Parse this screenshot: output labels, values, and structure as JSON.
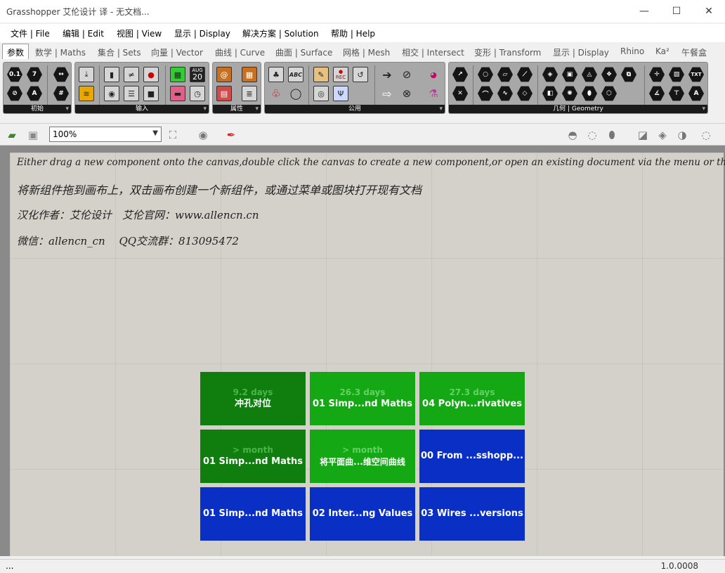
{
  "window": {
    "title": "Grasshopper 艾伦设计 译 - 无文档..."
  },
  "menu": [
    "文件 | File",
    "编辑 | Edit",
    "视图 | View",
    "显示 | Display",
    "解决方案 | Solution",
    "帮助 | Help"
  ],
  "tabs": [
    "参数",
    "数学 | Maths",
    "集合 | Sets",
    "向量 | Vector",
    "曲线 | Curve",
    "曲面 | Surface",
    "网格 | Mesh",
    "相交 | Intersect",
    "变形 | Transform",
    "显示 | Display",
    "Rhino",
    "Ka²",
    "午餐盒"
  ],
  "ribbon": {
    "groups": [
      "初始",
      "输入",
      "属性",
      "公用",
      "几何 | Geometry"
    ],
    "icon_labels": {
      "zero_one": "0.1",
      "seven": "7",
      "letter_a": "A",
      "calendar_month": "AUG",
      "calendar_day": "20",
      "abc": "ABC",
      "rec": "REC",
      "txt": "TXT"
    }
  },
  "toolbar": {
    "zoom": "100%"
  },
  "canvas": {
    "lines": [
      "Either drag a new component onto the canvas,double click the canvas to create a new component,or open an existing document via the menu or the tiles.",
      "将新组件拖到画布上，双击画布创建一个新组件，或通过菜单或图块打开现有文档",
      "汉化作者：艾伦设计　艾伦官网：www.allencn.cn",
      "微信：allencn_cn　 QQ交流群：813095472"
    ],
    "tiles": [
      {
        "top": "9.2 days",
        "bottom": "冲孔对位",
        "color": "#0f7e0f",
        "topColor": "#49b649"
      },
      {
        "top": "26.3 days",
        "bottom": "01 Simp...nd Maths",
        "color": "#14a814",
        "topColor": "#63d163"
      },
      {
        "top": "27.3 days",
        "bottom": "04 Polyn...rivatives",
        "color": "#14a814",
        "topColor": "#63d163"
      },
      {
        "top": "> month",
        "bottom": "01 Simp...nd Maths",
        "color": "#0f7e0f",
        "topColor": "#49b649"
      },
      {
        "top": "> month",
        "bottom": "将平面曲...维空间曲线",
        "color": "#14a814",
        "topColor": "#63d163"
      },
      {
        "top": "",
        "bottom": "00  From  ...sshopp...",
        "color": "#0a2fc4",
        "topColor": "#6a86e8"
      },
      {
        "top": "",
        "bottom": "01 Simp...nd Maths",
        "color": "#0a2fc4",
        "topColor": "#6a86e8"
      },
      {
        "top": "",
        "bottom": "02 Inter...ng Values",
        "color": "#0a2fc4",
        "topColor": "#6a86e8"
      },
      {
        "top": "",
        "bottom": "03 Wires ...versions",
        "color": "#0a2fc4",
        "topColor": "#6a86e8"
      }
    ]
  },
  "status": {
    "left": "...",
    "version": "1.0.0008"
  }
}
